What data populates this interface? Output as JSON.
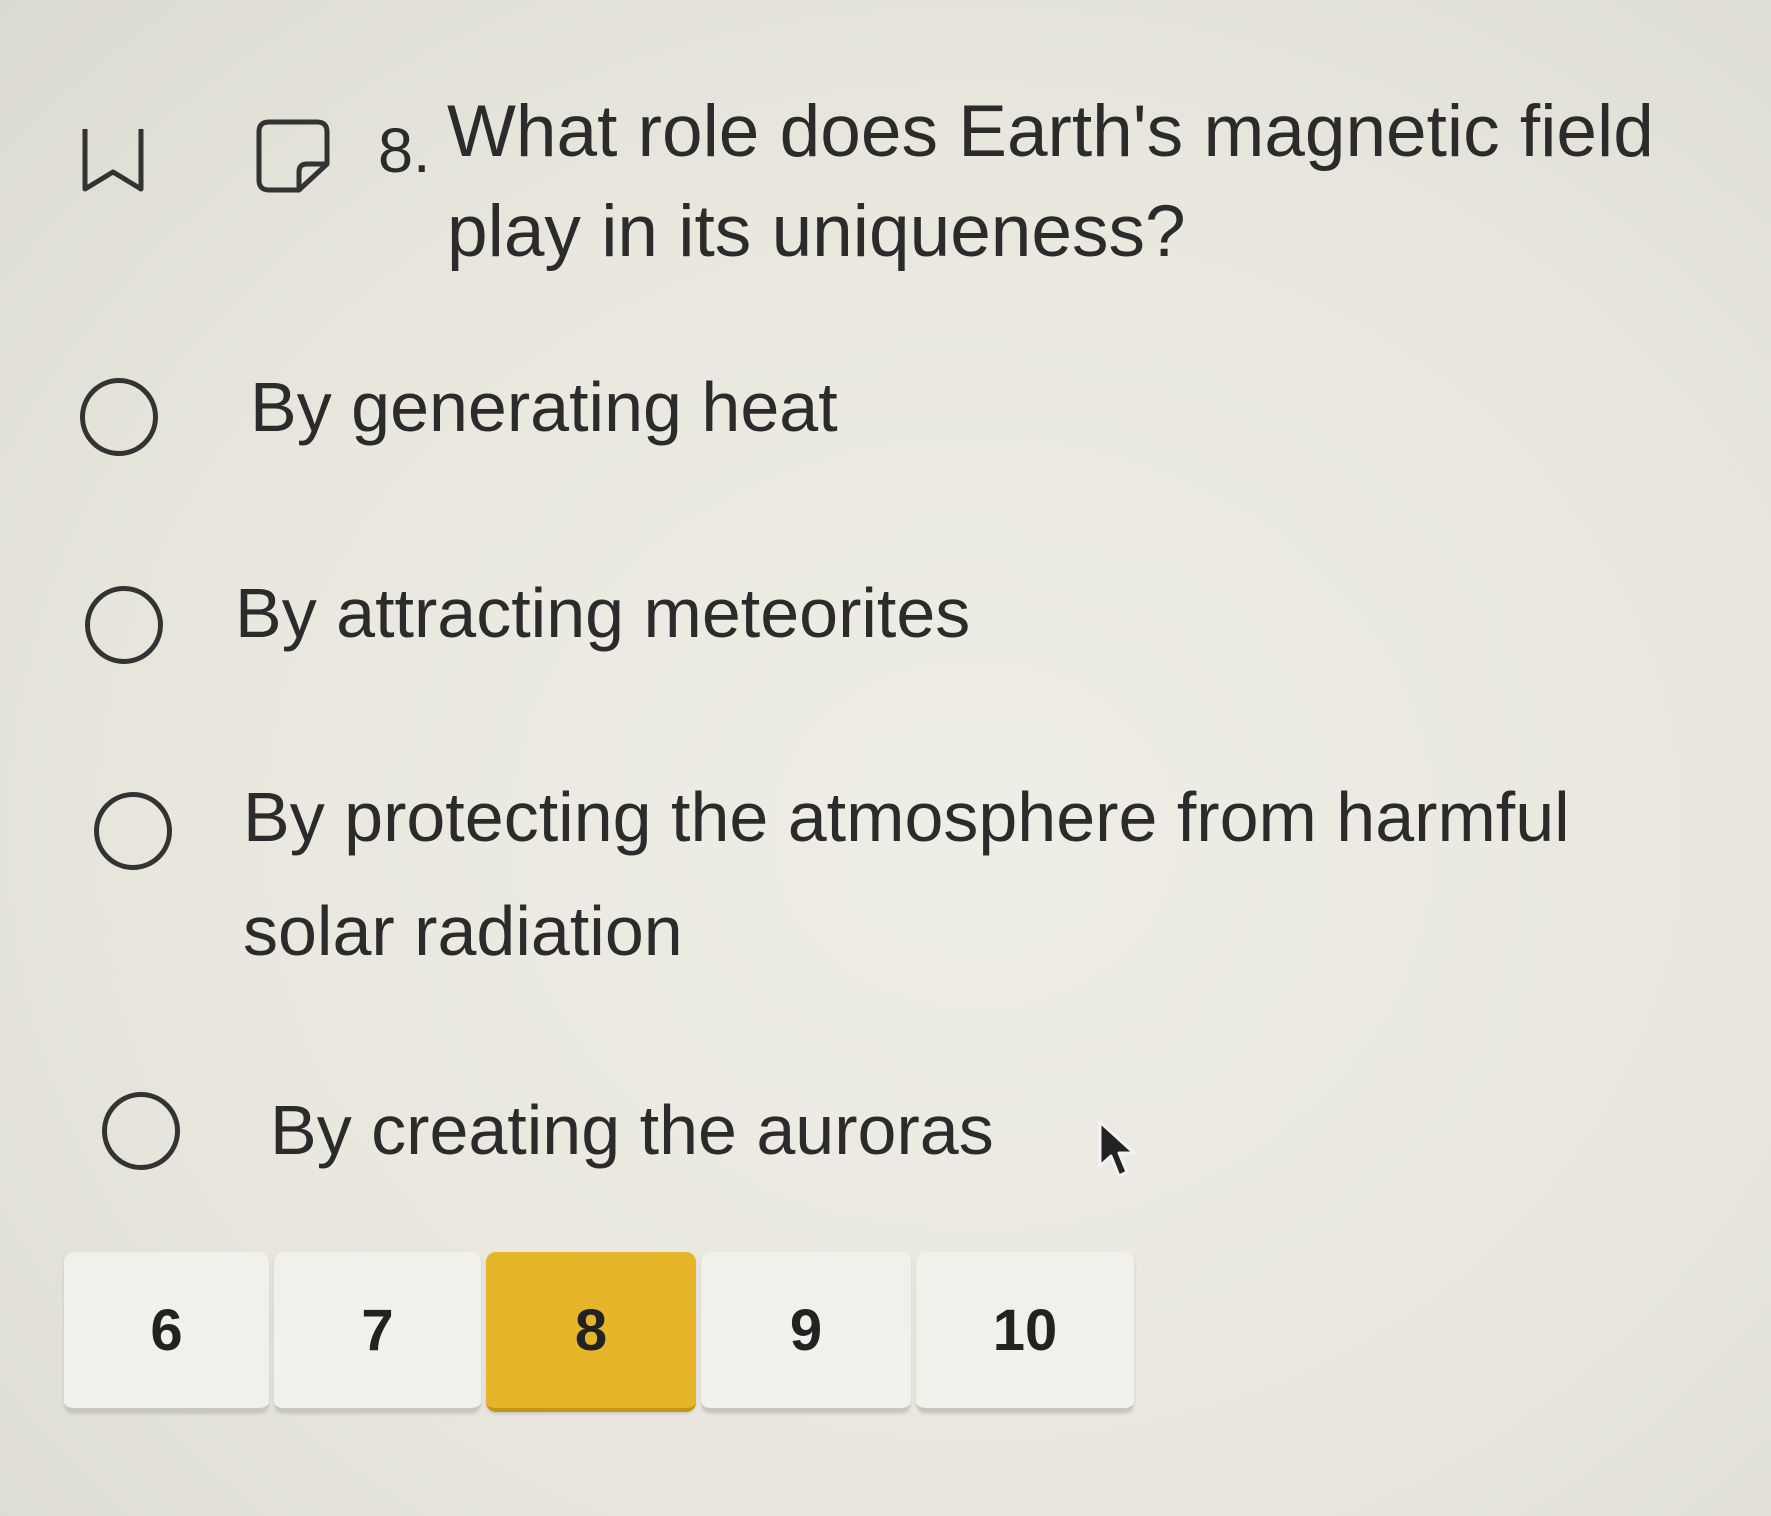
{
  "toolbar": {
    "bookmark_icon": "bookmark-icon",
    "note_icon": "sticky-note-icon"
  },
  "question": {
    "number": "8.",
    "text": "What role does Earth's magnetic field play in its uniqueness?"
  },
  "options": [
    {
      "label": "By generating heat",
      "selected": false
    },
    {
      "label": "By attracting meteorites",
      "selected": false
    },
    {
      "label": "By protecting the atmosphere from harmful solar radiation",
      "selected": false
    },
    {
      "label": "By creating the auroras",
      "selected": false
    }
  ],
  "pagination": {
    "pages": [
      "6",
      "7",
      "8",
      "9",
      "10"
    ],
    "current": "8",
    "active_color": "#e6b52a"
  },
  "cursor_icon": "mouse-pointer-icon"
}
